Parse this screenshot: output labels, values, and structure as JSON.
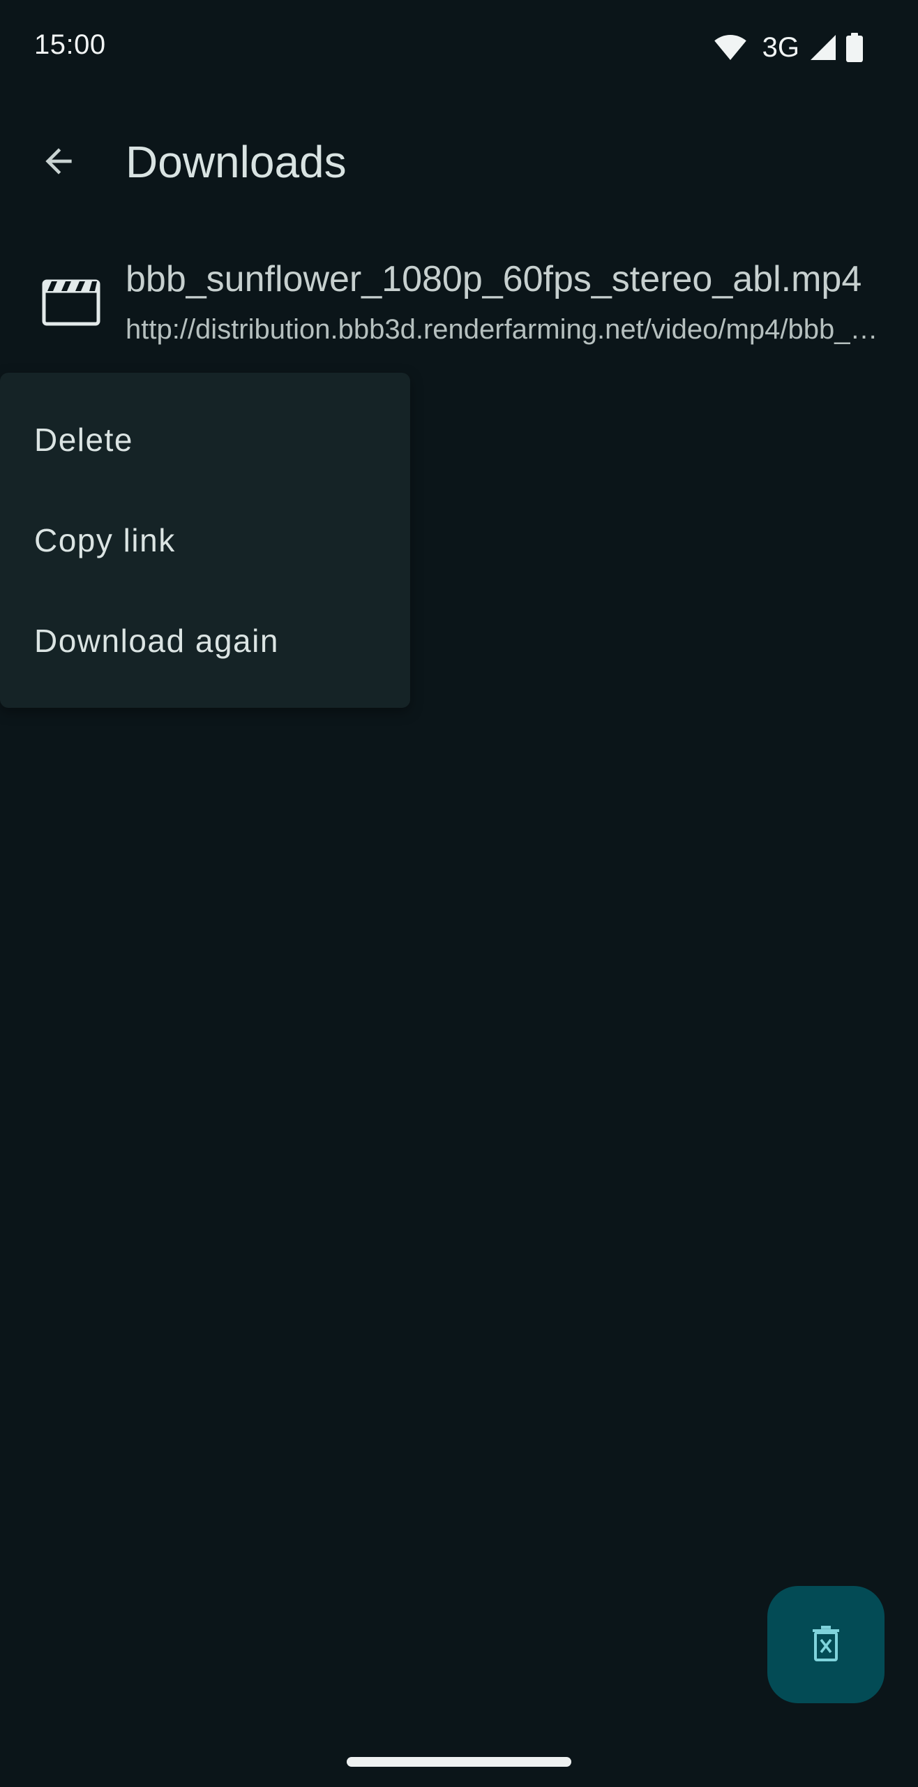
{
  "status_bar": {
    "time": "15:00",
    "network_label": "3G",
    "icons": [
      "wifi-icon",
      "cell-signal-icon",
      "battery-icon"
    ]
  },
  "app_bar": {
    "title": "Downloads",
    "back_icon": "arrow-back-icon"
  },
  "downloads": [
    {
      "icon": "movie-clapper-icon",
      "file_name": "bbb_sunflower_1080p_60fps_stereo_abl.mp4",
      "url": "http://distribution.bbb3d.renderfarming.net/video/mp4/bbb_sunflower_1080p_60fps_stereo_abl.mp4"
    }
  ],
  "context_menu": {
    "items": [
      {
        "label": "Delete"
      },
      {
        "label": "Copy link"
      },
      {
        "label": "Download again"
      }
    ]
  },
  "fab": {
    "icon": "delete-all-icon"
  },
  "colors": {
    "background": "#0b1519",
    "menu_surface": "#152326",
    "fab": "#034b55",
    "fab_icon": "#7fd3dc",
    "text_primary": "#d9e3e2"
  }
}
